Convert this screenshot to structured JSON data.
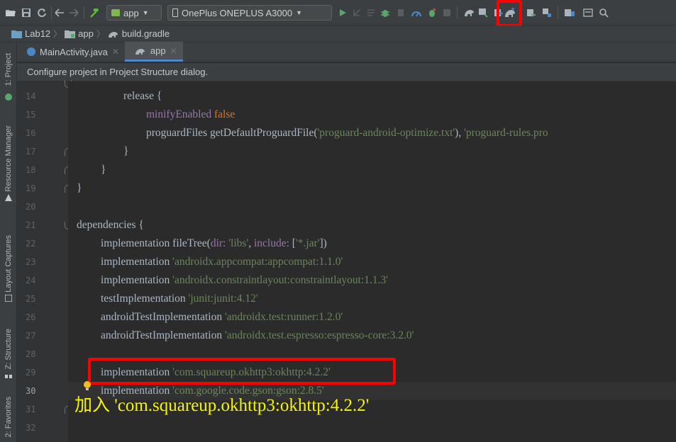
{
  "toolbar": {
    "config_name": "app",
    "device_name": "OnePlus ONEPLUS A3000"
  },
  "breadcrumb": {
    "items": [
      "Lab12",
      "app",
      "build.gradle"
    ]
  },
  "side_tabs": {
    "project": "1: Project",
    "resource_manager": "Resource Manager",
    "layout_captures": "Layout Captures",
    "structure": "Z: Structure",
    "favorites": "2: Favorites"
  },
  "tabs": [
    {
      "label": "MainActivity.java",
      "active": false
    },
    {
      "label": "app",
      "active": true
    }
  ],
  "notification": "Configure project in Project Structure dialog.",
  "code": {
    "current_line": 30,
    "lines": [
      {
        "n": "14",
        "text": "        release {"
      },
      {
        "n": "15",
        "text": "            minifyEnabled false"
      },
      {
        "n": "16",
        "text": "            proguardFiles getDefaultProguardFile('proguard-android-optimize.txt'), 'proguard-rules.pro"
      },
      {
        "n": "17",
        "text": "        }"
      },
      {
        "n": "18",
        "text": "    }"
      },
      {
        "n": "19",
        "text": "}"
      },
      {
        "n": "20",
        "text": ""
      },
      {
        "n": "21",
        "text": "dependencies {"
      },
      {
        "n": "22",
        "text": "    implementation fileTree(dir: 'libs', include: ['*.jar'])"
      },
      {
        "n": "23",
        "text": "    implementation 'androidx.appcompat:appcompat:1.1.0'"
      },
      {
        "n": "24",
        "text": "    implementation 'androidx.constraintlayout:constraintlayout:1.1.3'"
      },
      {
        "n": "25",
        "text": "    testImplementation 'junit:junit:4.12'"
      },
      {
        "n": "26",
        "text": "    androidTestImplementation 'androidx.test:runner:1.2.0'"
      },
      {
        "n": "27",
        "text": "    androidTestImplementation 'androidx.test.espresso:espresso-core:3.2.0'"
      },
      {
        "n": "28",
        "text": ""
      },
      {
        "n": "29",
        "text": "    implementation 'com.squareup.okhttp3:okhttp:4.2.2'"
      },
      {
        "n": "30",
        "text": "    implementation 'com.google.code.gson:gson:2.8.5'"
      },
      {
        "n": "31",
        "text": ""
      },
      {
        "n": "32",
        "text": ""
      }
    ]
  },
  "annotation": {
    "caption": "加入 'com.squareup.okhttp3:okhttp:4.2.2'",
    "color": "#ffff00",
    "highlight_color": "#ff0000"
  },
  "colors": {
    "keyword": "#cc7832",
    "string": "#6a8759",
    "property": "#9876aa",
    "text": "#a9b7c6",
    "background": "#2b2b2b"
  }
}
